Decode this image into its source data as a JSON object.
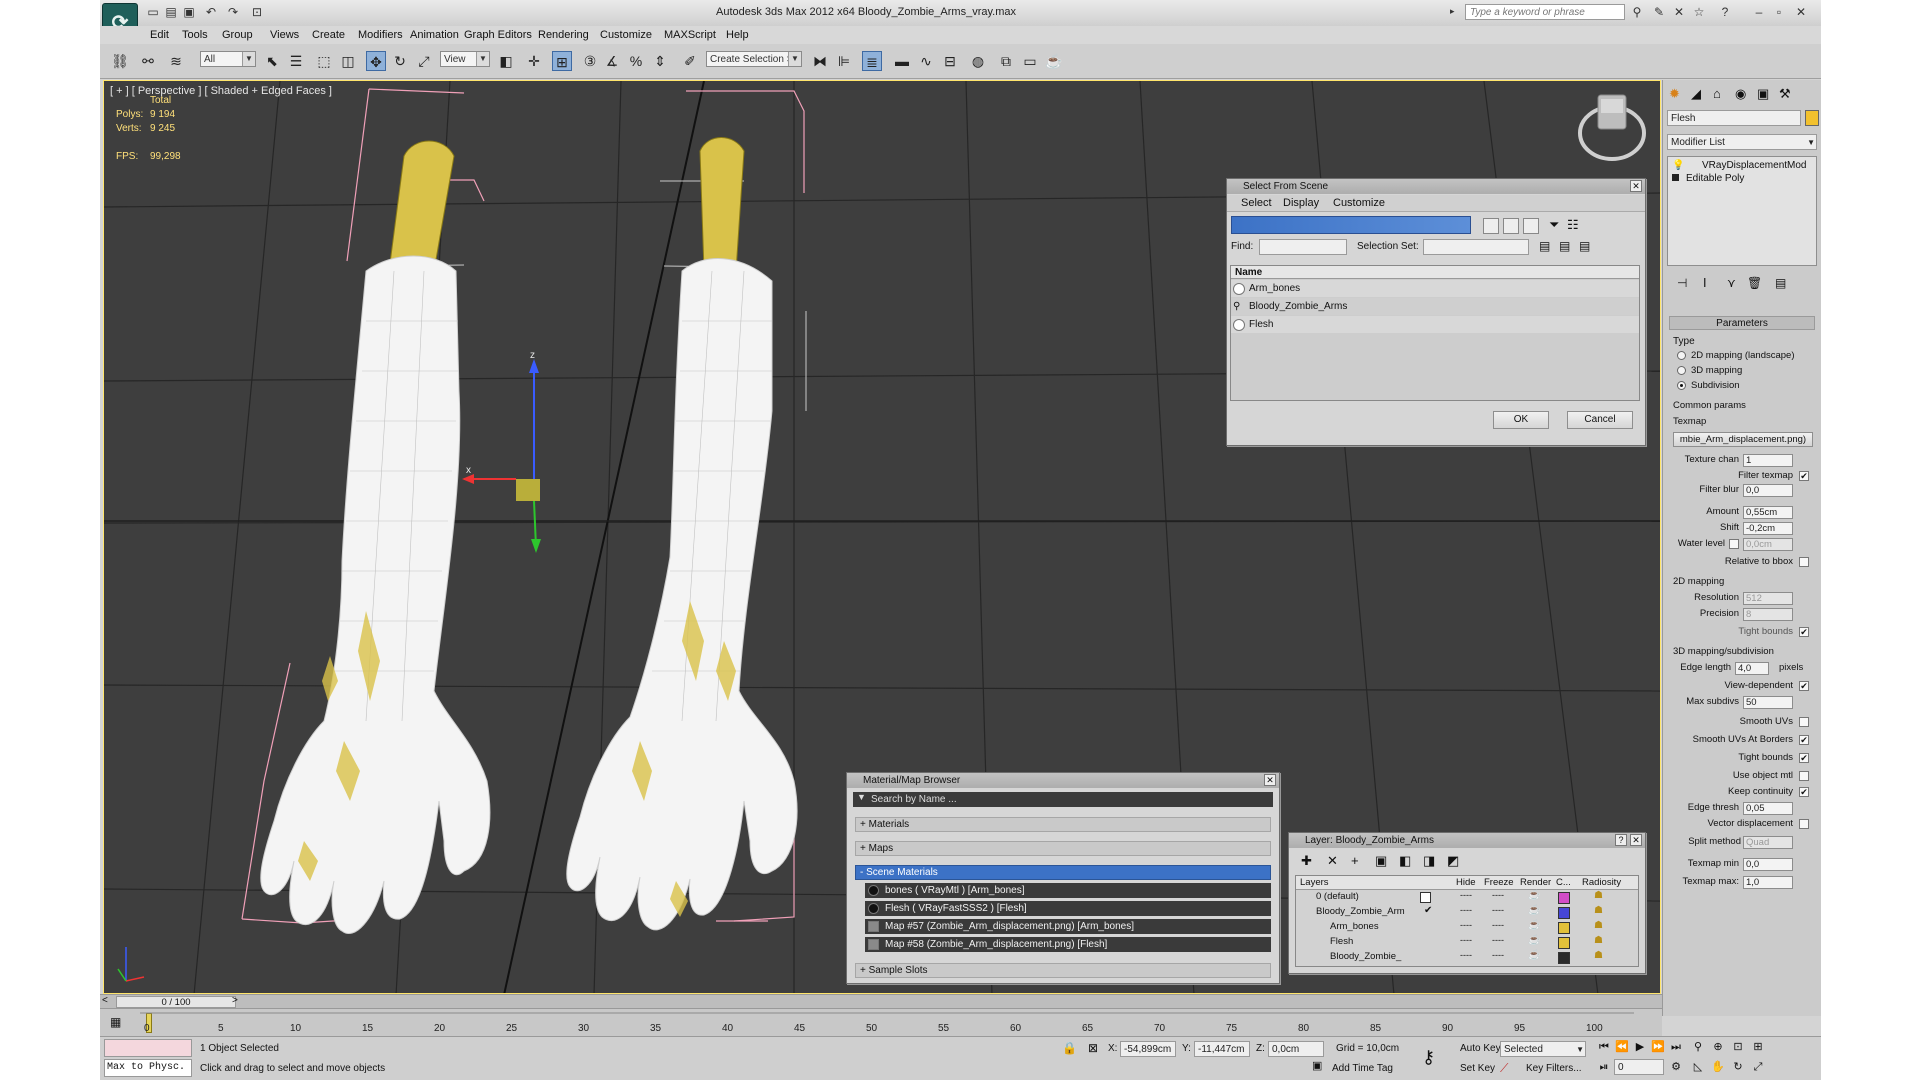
{
  "window": {
    "title": "Autodesk 3ds Max  2012 x64     Bloody_Zombie_Arms_vray.max",
    "search_placeholder": "Type a keyword or phrase",
    "app_logo": "3ds Max"
  },
  "menu": [
    "Edit",
    "Tools",
    "Group",
    "Views",
    "Create",
    "Modifiers",
    "Animation",
    "Graph Editors",
    "Rendering",
    "Customize",
    "MAXScript",
    "Help"
  ],
  "toolbar": {
    "filter": "All",
    "ref_coord": "View",
    "selection_set": "Create Selection Se"
  },
  "viewport": {
    "label": "[ + ] [ Perspective ] [ Shaded + Edged Faces ]",
    "stats": {
      "total_label": "Total",
      "polys_label": "Polys:",
      "polys": "9 194",
      "verts_label": "Verts:",
      "verts": "9 245",
      "fps_label": "FPS:",
      "fps": "99,298"
    },
    "gizmo_x": "x",
    "gizmo_y": "y",
    "gizmo_z": "z"
  },
  "command_panel": {
    "object_name": "Flesh",
    "object_color": "#f2c12e",
    "modifier_list": "Modifier List",
    "stack": [
      "VRayDisplacementMod",
      "Editable Poly"
    ],
    "rollout": "Parameters",
    "type_label": "Type",
    "type_options": [
      "2D mapping (landscape)",
      "3D mapping",
      "Subdivision"
    ],
    "common_params": "Common params",
    "texmap_label": "Texmap",
    "texmap_value": "mbie_Arm_displacement.png)",
    "texture_chan": "Texture chan",
    "texture_chan_value": "1",
    "filter_texmap": "Filter texmap",
    "filter_blur": "Filter blur",
    "filter_blur_value": "0,0",
    "amount": "Amount",
    "amount_value": "0,55cm",
    "shift": "Shift",
    "shift_value": "-0,2cm",
    "water_level": "Water level",
    "water_level_value": "0,0cm",
    "relative_bbox": "Relative to bbox",
    "mapping2d": "2D mapping",
    "resolution": "Resolution",
    "resolution_value": "512",
    "precision": "Precision",
    "precision_value": "8",
    "tight_bounds": "Tight bounds",
    "mapping3d": "3D mapping/subdivision",
    "edge_length": "Edge length",
    "edge_length_value": "4,0",
    "pixels": "pixels",
    "view_dependent": "View-dependent",
    "max_subdivs": "Max subdivs",
    "max_subdivs_value": "50",
    "smooth_uvs": "Smooth UVs",
    "smooth_uvs_borders": "Smooth UVs At Borders",
    "tight_bounds2": "Tight bounds",
    "use_object_mtl": "Use object mtl",
    "keep_continuity": "Keep continuity",
    "edge_thresh": "Edge thresh",
    "edge_thresh_value": "0,05",
    "vector_displacement": "Vector displacement",
    "split_method": "Split method",
    "split_method_value": "Quad",
    "texmap_min": "Texmap min",
    "texmap_min_value": "0,0",
    "texmap_max": "Texmap max:",
    "texmap_max_value": "1,0"
  },
  "select_dialog": {
    "title": "Select From Scene",
    "menu": [
      "Select",
      "Display",
      "Customize"
    ],
    "find_label": "Find:",
    "selection_set_label": "Selection Set:",
    "column_name": "Name",
    "items": [
      "Arm_bones",
      "Bloody_Zombie_Arms",
      "Flesh"
    ],
    "ok": "OK",
    "cancel": "Cancel"
  },
  "material_browser": {
    "title": "Material/Map Browser",
    "search": "Search by Name ...",
    "groups": [
      "+ Materials",
      "+ Maps",
      "- Scene Materials"
    ],
    "scene_materials": [
      "bones  ( VRayMtl ) [Arm_bones]",
      "Flesh  ( VRayFastSSS2 ) [Flesh]",
      "Map #57 (Zombie_Arm_displacement.png) [Arm_bones]",
      "Map #58 (Zombie_Arm_displacement.png) [Flesh]"
    ],
    "sample_slots": "+ Sample Slots"
  },
  "layer_dialog": {
    "title": "Layer: Bloody_Zombie_Arms",
    "columns": [
      "Layers",
      "Hide",
      "Freeze",
      "Render",
      "C...",
      "Radiosity"
    ],
    "rows": [
      {
        "name": "0 (default)",
        "color": "#d24dc7"
      },
      {
        "name": "Bloody_Zombie_Arm",
        "color": "#4646d6"
      },
      {
        "name": "Arm_bones",
        "color": "#e2c13a"
      },
      {
        "name": "Flesh",
        "color": "#e2c13a"
      },
      {
        "name": "Bloody_Zombie_",
        "color": "#2b2b2b"
      }
    ]
  },
  "timeline": {
    "frame": "0 / 100",
    "ticks": [
      "0",
      "5",
      "10",
      "15",
      "20",
      "25",
      "30",
      "35",
      "40",
      "45",
      "50",
      "55",
      "60",
      "65",
      "70",
      "75",
      "80",
      "85",
      "90",
      "95",
      "100"
    ]
  },
  "status": {
    "maxscript": "Max to Physc.",
    "selected": "1 Object Selected",
    "prompt": "Click and drag to select and move objects",
    "x_label": "X:",
    "x": "-54,899cm",
    "y_label": "Y:",
    "y": "-11,447cm",
    "z_label": "Z:",
    "z": "0,0cm",
    "grid": "Grid = 10,0cm",
    "add_time_tag": "Add Time Tag",
    "auto_key": "Auto Key",
    "set_key": "Set Key",
    "key_mode": "Selected",
    "key_filters": "Key Filters...",
    "frame_field": "0"
  }
}
